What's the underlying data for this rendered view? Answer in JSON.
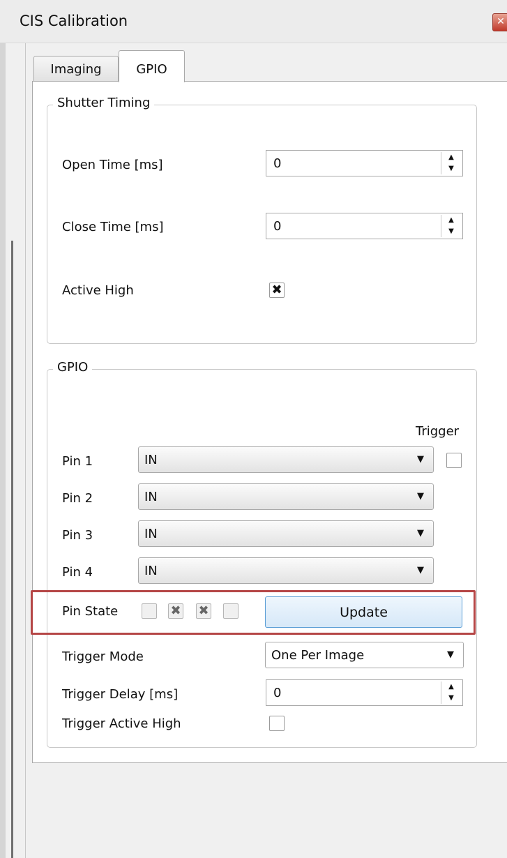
{
  "window": {
    "title": "CIS Calibration",
    "close_glyph": "✕"
  },
  "tabs": [
    {
      "label": "Imaging",
      "active": false
    },
    {
      "label": "GPIO",
      "active": true
    }
  ],
  "shutter_timing": {
    "title": "Shutter Timing",
    "open_time": {
      "label": "Open Time [ms]",
      "value": "0"
    },
    "close_time": {
      "label": "Close Time [ms]",
      "value": "0"
    },
    "active_high": {
      "label": "Active High",
      "checked": true
    }
  },
  "gpio": {
    "title": "GPIO",
    "trigger_header": "Trigger",
    "pins": [
      {
        "label": "Pin 1",
        "value": "IN",
        "has_trigger": true,
        "trigger_checked": false
      },
      {
        "label": "Pin 2",
        "value": "IN"
      },
      {
        "label": "Pin 3",
        "value": "IN"
      },
      {
        "label": "Pin 4",
        "value": "IN"
      }
    ],
    "pin_state": {
      "label": "Pin State",
      "states": [
        false,
        true,
        true,
        false
      ]
    },
    "update_label": "Update",
    "trigger_mode": {
      "label": "Trigger Mode",
      "value": "One Per Image"
    },
    "trigger_delay": {
      "label": "Trigger Delay [ms]",
      "value": "0"
    },
    "trigger_active_high": {
      "label": "Trigger Active High",
      "checked": false
    }
  },
  "icons": {
    "spin_up": "up-arrow-icon",
    "spin_down": "down-arrow-icon",
    "combo": "chevron-down-icon",
    "check": "x-mark-icon"
  },
  "colors": {
    "highlight": "#b54646",
    "update_border": "#5d9fd6",
    "close_button": "#c0392b"
  }
}
